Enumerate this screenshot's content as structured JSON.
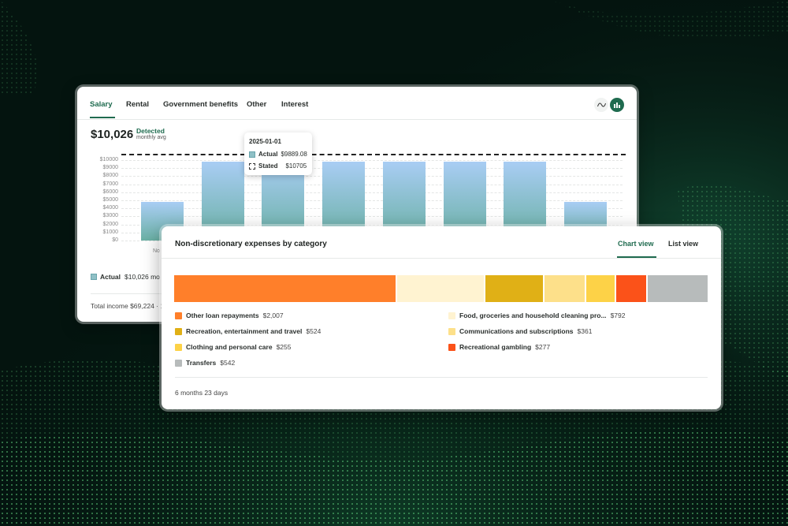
{
  "colors": {
    "brand_green": "#1f6b4f",
    "bar_gradient_top": "#a9cdf4",
    "bar_gradient_bottom": "#6ab0a4"
  },
  "income_card": {
    "tabs": [
      {
        "label": "Salary",
        "active": true
      },
      {
        "label": "Rental"
      },
      {
        "label": "Government benefits"
      },
      {
        "label": "Other"
      },
      {
        "label": "Interest"
      }
    ],
    "view_toggle": {
      "line_icon": "line-chart-icon",
      "bar_icon": "bar-chart-icon",
      "active": "bar"
    },
    "summary": {
      "amount": "$10,026",
      "status": "Detected",
      "sub": "monthly avg"
    },
    "tooltip": {
      "date": "2025-01-01",
      "actual_label": "Actual",
      "actual_value": "$9889.08",
      "stated_label": "Stated",
      "stated_value": "$10705"
    },
    "legend": {
      "label": "Actual",
      "text": "$10,026 mo"
    },
    "total": "Total income $69,224 · 1"
  },
  "chart_data": {
    "type": "bar",
    "yticks": [
      "$10000",
      "$9000",
      "$8000",
      "$7000",
      "$6000",
      "$5000",
      "$4000",
      "$3000",
      "$2000",
      "$1000",
      "$0"
    ],
    "ylim": [
      0,
      10000
    ],
    "categories": [
      "No",
      "",
      "",
      "",
      "",
      "",
      "",
      ""
    ],
    "values": [
      4800,
      9800,
      9889,
      9800,
      9800,
      9800,
      9800,
      4800
    ],
    "stated_value": 10705,
    "legend": [
      "Actual",
      "Stated"
    ]
  },
  "expenses_card": {
    "title": "Non-discretionary expenses by category",
    "view_tabs": [
      {
        "label": "Chart view",
        "active": true
      },
      {
        "label": "List view"
      }
    ],
    "categories": [
      {
        "name": "Other loan repayments",
        "value": 2007,
        "display": "$2,007",
        "color": "#ff7f2a"
      },
      {
        "name": "Food, groceries and household cleaning pro...",
        "value": 792,
        "display": "$792",
        "color": "#fff3d1"
      },
      {
        "name": "Recreation, entertainment and travel",
        "value": 524,
        "display": "$524",
        "color": "#e0b016"
      },
      {
        "name": "Communications and subscriptions",
        "value": 361,
        "display": "$361",
        "color": "#fde08a"
      },
      {
        "name": "Clothing and personal care",
        "value": 255,
        "display": "$255",
        "color": "#fdd247"
      },
      {
        "name": "Recreational gambling",
        "value": 277,
        "display": "$277",
        "color": "#fb5219"
      },
      {
        "name": "Transfers",
        "value": 542,
        "display": "$542",
        "color": "#b7bbbb"
      }
    ],
    "duration": "6 months 23 days"
  }
}
